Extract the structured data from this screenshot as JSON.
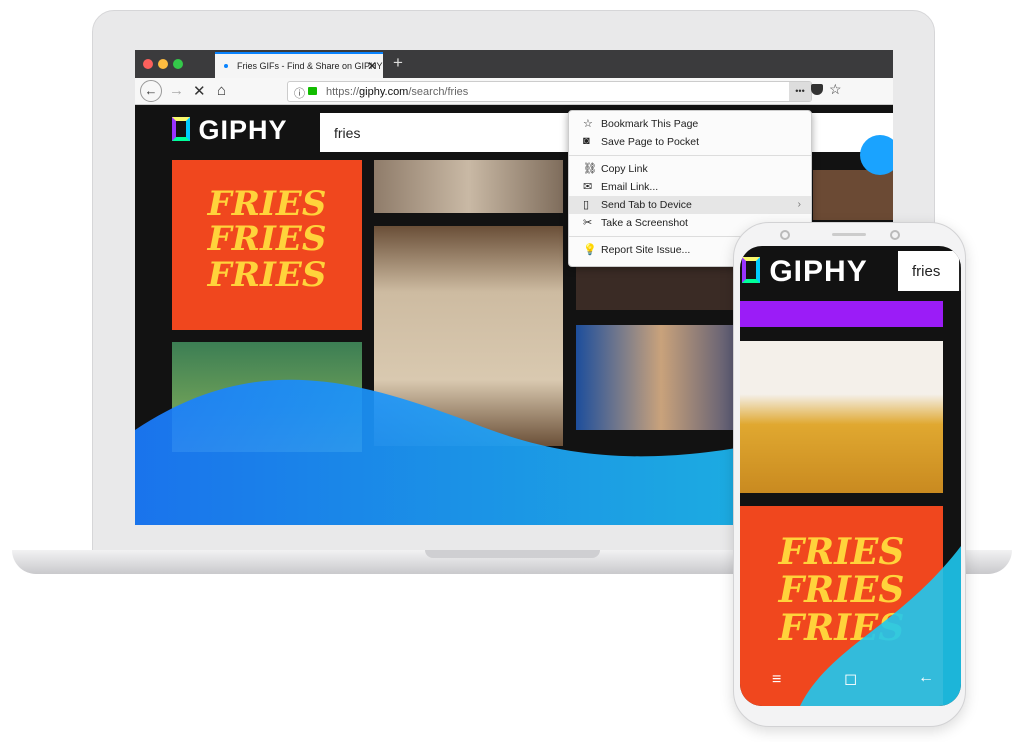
{
  "browser": {
    "tab_title": "Fries GIFs - Find & Share on GIPHY",
    "new_tab_label": "+",
    "url_prefix": "https://",
    "url_domain": "giphy.com",
    "url_path": "/search/fries",
    "page_actions_label": "•••"
  },
  "giphy": {
    "logo": "GIPHY",
    "search_value": "fries"
  },
  "gif_art": {
    "fries_text": "FRIES FRIES FRIES"
  },
  "menu": {
    "items": [
      {
        "icon": "star-icon",
        "label": "Bookmark This Page"
      },
      {
        "icon": "pocket-icon",
        "label": "Save Page to Pocket"
      },
      {
        "icon": "link-icon",
        "label": "Copy Link"
      },
      {
        "icon": "email-icon",
        "label": "Email Link..."
      },
      {
        "icon": "device-icon",
        "label": "Send Tab to Device",
        "submenu": true
      },
      {
        "icon": "screenshot-icon",
        "label": "Take a Screenshot"
      },
      {
        "icon": "bulb-icon",
        "label": "Report Site Issue..."
      }
    ]
  },
  "phone": {
    "logo": "GIPHY",
    "search_value": "fries"
  },
  "colors": {
    "accent_blue": "#0a84ff",
    "wave_cyan": "#1ec8f0",
    "wave_blue": "#1a7cff",
    "purple": "#9b1cf7",
    "fries_red": "#f0471e"
  }
}
